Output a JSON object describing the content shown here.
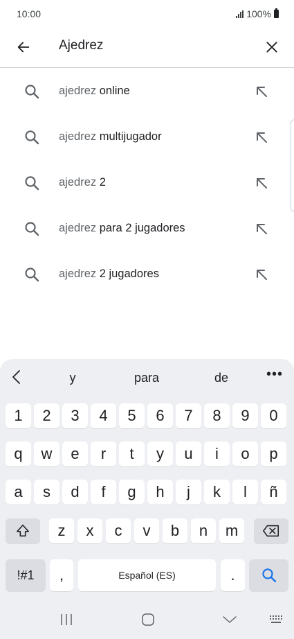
{
  "status_bar": {
    "time": "10:00",
    "battery_text": "100%"
  },
  "search": {
    "query": "Ajedrez"
  },
  "suggestions": [
    {
      "prefix": "ajedrez",
      "rest": " online"
    },
    {
      "prefix": "ajedrez",
      "rest": " multijugador"
    },
    {
      "prefix": "ajedrez",
      "rest": " 2"
    },
    {
      "prefix": "ajedrez",
      "rest": " para 2 jugadores"
    },
    {
      "prefix": "ajedrez",
      "rest": " 2 jugadores"
    }
  ],
  "keyboard": {
    "predictions": [
      "y",
      "para",
      "de"
    ],
    "more_label": "•••",
    "row_numbers": [
      "1",
      "2",
      "3",
      "4",
      "5",
      "6",
      "7",
      "8",
      "9",
      "0"
    ],
    "row_1": [
      "q",
      "w",
      "e",
      "r",
      "t",
      "y",
      "u",
      "i",
      "o",
      "p"
    ],
    "row_2": [
      "a",
      "s",
      "d",
      "f",
      "g",
      "h",
      "j",
      "k",
      "l",
      "ñ"
    ],
    "row_3": [
      "z",
      "x",
      "c",
      "v",
      "b",
      "n",
      "m"
    ],
    "symbols_label": "!#1",
    "comma_label": ",",
    "space_label": "Español (ES)",
    "period_label": "."
  },
  "icons": {
    "back": "arrow-left-icon",
    "clear": "close-icon",
    "suggestion_search": "search-icon",
    "suggestion_fill": "arrow-up-left-icon",
    "shift": "shift-icon",
    "backspace": "backspace-icon",
    "search_key": "search-icon"
  },
  "colors": {
    "accent": "#1a73e8",
    "keyboard_bg": "#eeeff3",
    "key_bg": "#ffffff",
    "dark_key_bg": "#dcdde2"
  }
}
